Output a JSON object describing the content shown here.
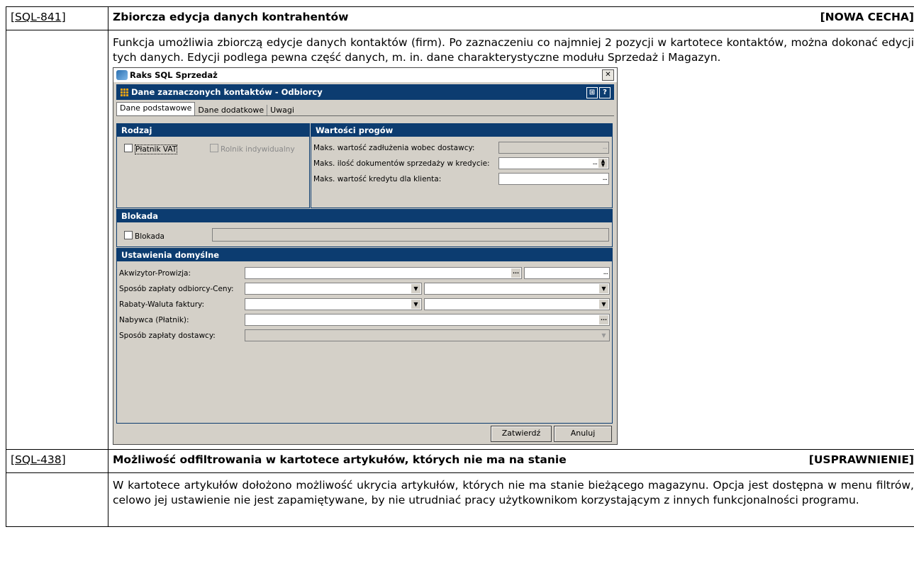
{
  "rows": [
    {
      "ticket": "[SQL-841]",
      "title": "Zbiorcza edycja danych kontrahentów",
      "tag": "[NOWA CECHA]",
      "body": "Funkcja umożliwia zbiorczą edycje danych kontaktów (firm). Po zaznaczeniu co najmniej 2 pozycji w kartotece kontaktów, można dokonać edycji tych danych. Edycji podlega pewna część danych, m. in. dane charakterystyczne modułu Sprzedaż i Magazyn."
    },
    {
      "ticket": "[SQL-438]",
      "title": "Możliwość odfiltrowania w kartotece artykułów, których nie ma na stanie",
      "tag": "[USPRAWNIENIE]",
      "body": "W kartotece artykułów dołożono możliwość ukrycia artykułów, których nie ma stanie bieżącego magazynu. Opcja jest dostępna w menu filtrów, celowo jej ustawienie nie jest zapamiętywane, by nie utrudniać pracy użytkownikom korzystającym z innych funkcjonalności programu."
    }
  ],
  "dialog": {
    "window_title": "Raks SQL Sprzedaż",
    "close_glyph": "✕",
    "subtitle": "Dane zaznaczonych kontaktów - Odbiorcy",
    "tabs": [
      "Dane podstawowe",
      "Dane dodatkowe",
      "Uwagi"
    ],
    "rodzaj": {
      "header": "Rodzaj",
      "platnik_vat": "Płatnik VAT",
      "rolnik": "Rolnik indywidualny"
    },
    "progi": {
      "header": "Wartości progów",
      "l1": "Maks. wartość zadłużenia wobec dostawcy:",
      "l2": "Maks. ilość dokumentów sprzedaży w kredycie:",
      "l3": "Maks. wartość kredytu dla klienta:"
    },
    "blokada": {
      "header": "Blokada",
      "checkbox": "Blokada"
    },
    "ustawienia": {
      "header": "Ustawienia domyślne",
      "l1": "Akwizytor-Prowizja:",
      "l2": "Sposób zapłaty odbiorcy-Ceny:",
      "l3": "Rabaty-Waluta faktury:",
      "l4": "Nabywca (Płatnik):",
      "l5": "Sposób zapłaty dostawcy:"
    },
    "buttons": {
      "confirm": "Zatwierdź",
      "cancel": "Anuluj"
    },
    "colors": {
      "header_bg": "#0c3c70",
      "window_bg": "#d4d0c8"
    }
  }
}
